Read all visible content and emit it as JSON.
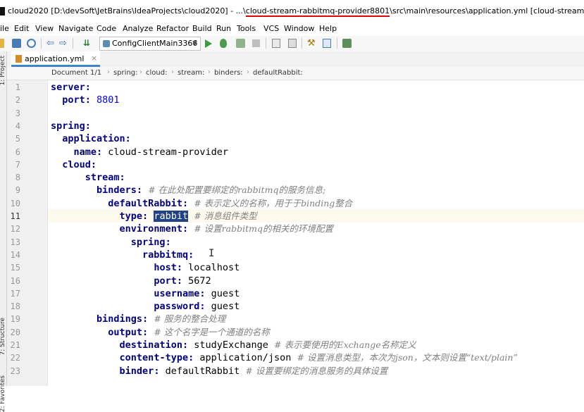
{
  "window": {
    "title_prefix": "cloud2020 [D:\\devSoft\\JetBrains\\IdeaProjects\\cloud2020] - ...\\",
    "title_highlight": "cloud-stream-rabbitmq-provider8801",
    "title_suffix": "\\src\\main\\resources\\application.yml [cloud-stream-rabbitmq-provide"
  },
  "menu": [
    "ile",
    "Edit",
    "View",
    "Navigate",
    "Code",
    "Analyze",
    "Refactor",
    "Build",
    "Run",
    "Tools",
    "VCS",
    "Window",
    "Help"
  ],
  "toolbar": {
    "run_config": "ConfigClientMain3366",
    "icons": [
      "open-icon",
      "save-icon",
      "sync-icon",
      "back-icon",
      "forward-icon",
      "build-icon",
      "run-icon",
      "debug-icon",
      "coverage-icon",
      "stop-icon",
      "project-structure-icon",
      "sdk-icon",
      "settings-icon",
      "tasks-icon",
      "terminal-icon"
    ]
  },
  "side_tools": {
    "project": "1: Project",
    "structure": "7: Structure",
    "favorites": "2: Favorites"
  },
  "tab": {
    "name": "application.yml",
    "close": "×"
  },
  "breadcrumb": [
    "Document 1/1",
    "spring:",
    "cloud:",
    "stream:",
    "binders:",
    "defaultRabbit:"
  ],
  "editor": {
    "current_line": 11,
    "lines": [
      {
        "n": "1",
        "indent": "",
        "key": "server:",
        "val": "",
        "comment": ""
      },
      {
        "n": "2",
        "indent": "  ",
        "key": "port:",
        "num": "8801",
        "val": "",
        "comment": ""
      },
      {
        "n": "3",
        "indent": "",
        "key": "",
        "val": "",
        "comment": ""
      },
      {
        "n": "4",
        "indent": "",
        "key": "spring:",
        "val": "",
        "comment": ""
      },
      {
        "n": "5",
        "indent": "  ",
        "key": "application:",
        "val": "",
        "comment": ""
      },
      {
        "n": "6",
        "indent": "    ",
        "key": "name:",
        "val": "cloud-stream-provider",
        "comment": ""
      },
      {
        "n": "7",
        "indent": "  ",
        "key": "cloud:",
        "val": "",
        "comment": ""
      },
      {
        "n": "8",
        "indent": "      ",
        "key": "stream:",
        "val": "",
        "comment": ""
      },
      {
        "n": "9",
        "indent": "        ",
        "key": "binders:",
        "val": "",
        "comment": "# 在此处配置要绑定的rabbitmq的服务信息;"
      },
      {
        "n": "10",
        "indent": "          ",
        "key": "defaultRabbit:",
        "val": "",
        "comment": "# 表示定义的名称，用于于binding整合"
      },
      {
        "n": "11",
        "indent": "            ",
        "key": "type:",
        "sel": "rabbit",
        "val": "",
        "comment": "# 消息组件类型"
      },
      {
        "n": "12",
        "indent": "            ",
        "key": "environment:",
        "val": "",
        "comment": "# 设置rabbitmq的相关的环境配置"
      },
      {
        "n": "13",
        "indent": "              ",
        "key": "spring:",
        "val": "",
        "comment": ""
      },
      {
        "n": "14",
        "indent": "                ",
        "key": "rabbitmq:",
        "val": "",
        "comment": ""
      },
      {
        "n": "15",
        "indent": "                  ",
        "key": "host:",
        "val": "localhost",
        "comment": ""
      },
      {
        "n": "16",
        "indent": "                  ",
        "key": "port:",
        "val": "5672",
        "comment": ""
      },
      {
        "n": "17",
        "indent": "                  ",
        "key": "username:",
        "val": "guest",
        "comment": ""
      },
      {
        "n": "18",
        "indent": "                  ",
        "key": "password:",
        "val": "guest",
        "comment": ""
      },
      {
        "n": "19",
        "indent": "        ",
        "key": "bindings:",
        "val": "",
        "comment": "# 服务的整合处理"
      },
      {
        "n": "20",
        "indent": "          ",
        "key": "output:",
        "val": "",
        "comment": "# 这个名字是一个通道的名称"
      },
      {
        "n": "21",
        "indent": "            ",
        "key": "destination:",
        "val": "studyExchange",
        "comment": "# 表示要使用的Exchange名称定义"
      },
      {
        "n": "22",
        "indent": "            ",
        "key": "content-type:",
        "val": "application/json",
        "comment": "# 设置消息类型，本次为json，文本则设置“text/plain”"
      },
      {
        "n": "23",
        "indent": "            ",
        "key": "binder:",
        "val": "defaultRabbit",
        "comment": "# 设置要绑定的消息服务的具体设置"
      }
    ]
  }
}
